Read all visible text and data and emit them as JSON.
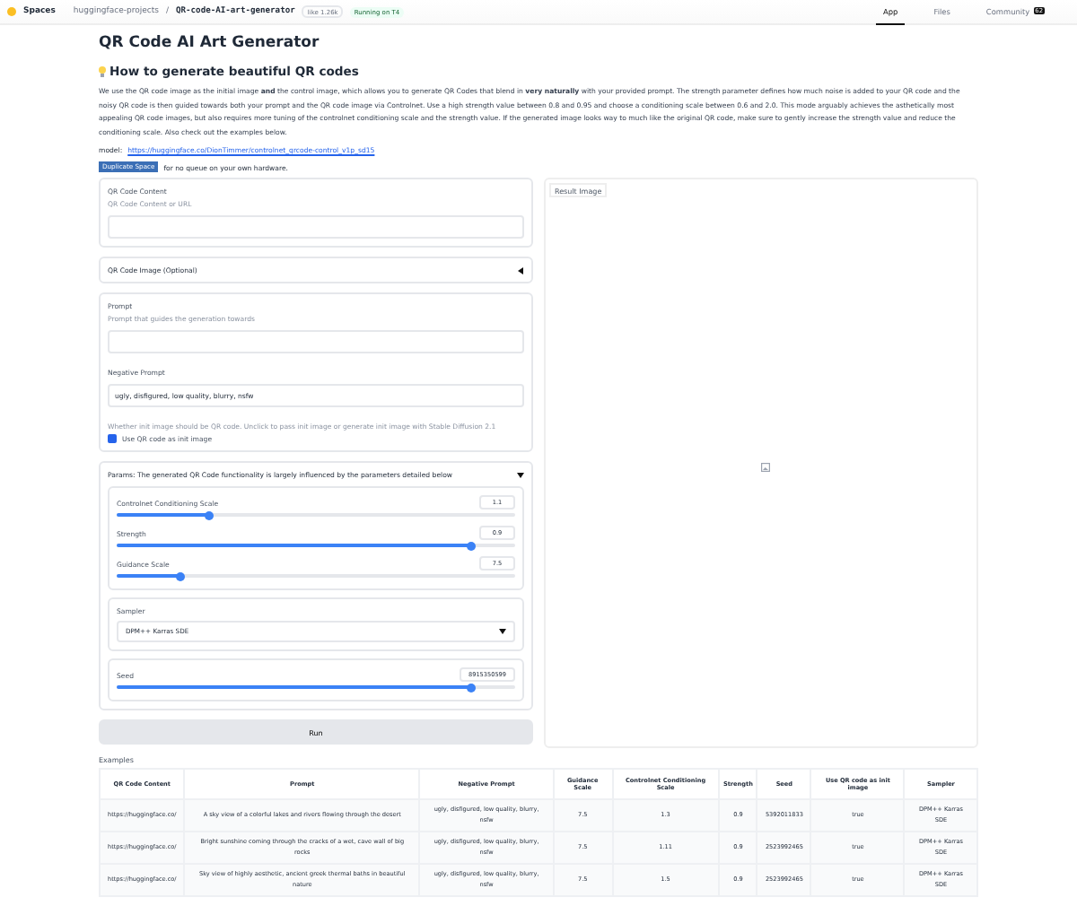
{
  "header": {
    "brand": "Spaces",
    "owner": "huggingface-projects",
    "slash": "/",
    "space": "QR-code-AI-art-generator",
    "like_label": "like",
    "like_count": "1.26k",
    "status": "Running on T4",
    "tabs": [
      {
        "label": "App",
        "selected": true
      },
      {
        "label": "Files",
        "selected": false
      },
      {
        "label": "Community",
        "selected": false,
        "count": "62"
      }
    ]
  },
  "title": "QR Code AI Art Generator",
  "subtitle": "How to generate beautiful QR codes",
  "description": "We use the QR code image as the initial image **and** the control image, which allows you to generate QR Codes that blend in **very naturally** with your provided prompt. The strength parameter defines how much noise is added to your QR code and the noisy QR code is then guided towards both your prompt and the QR code image via Controlnet. Use a high strength value between 0.8 and 0.95 and choose a conditioning scale between 0.6 and 2.0. This mode arguably achieves the asthetically most appealing QR code images, but also requires more tuning of the controlnet conditioning scale and the strength value. If the generated image looks way to much like the original QR code, make sure to gently increase the strength value and reduce the conditioning scale. Also check out the examples below.",
  "model_label": "model:",
  "model_link": "https://huggingface.co/DionTimmer/controlnet_qrcode-control_v1p_sd15",
  "duplicate": {
    "button": "Duplicate Space",
    "text": "for no queue on your own hardware."
  },
  "qr_content": {
    "label": "QR Code Content",
    "info": "QR Code Content or URL"
  },
  "qr_image": {
    "label": "QR Code Image (Optional)",
    "expanded": false
  },
  "prompt": {
    "label": "Prompt",
    "info": "Prompt that guides the generation towards"
  },
  "negative_prompt": {
    "label": "Negative Prompt",
    "value": "ugly, disfigured, low quality, blurry, nsfw"
  },
  "init_image": {
    "info": "Whether init image should be QR code. Unclick to pass init image or generate init image with Stable Diffusion 2.1",
    "label": "Use QR code as init image",
    "checked": true
  },
  "params": {
    "label": "Params: The generated QR Code functionality is largely influenced by the parameters detailed below",
    "expanded": true,
    "sliders": [
      {
        "label": "Controlnet Conditioning Scale",
        "value": "1.1",
        "level": 0.23
      },
      {
        "label": "Strength",
        "value": "0.9",
        "level": 0.89
      },
      {
        "label": "Guidance Scale",
        "value": "7.5",
        "level": 0.16
      }
    ],
    "sampler": {
      "label": "Sampler",
      "value": "DPM++ Karras SDE"
    },
    "seed": {
      "label": "Seed",
      "value": "8915350599",
      "level": 0.89
    }
  },
  "run": "Run",
  "result_label": "Result Image",
  "examples": {
    "label": "Examples",
    "columns": [
      "QR Code Content",
      "Prompt",
      "Negative Prompt",
      "Guidance Scale",
      "Controlnet Conditioning Scale",
      "Strength",
      "Seed",
      "Use QR code as init image",
      "Sampler"
    ],
    "rows": [
      [
        "https://huggingface.co/",
        "A sky view of a colorful lakes and rivers flowing through the desert",
        "ugly, disfigured, low quality, blurry, nsfw",
        "7.5",
        "1.3",
        "0.9",
        "5392011833",
        "true",
        "DPM++ Karras SDE"
      ],
      [
        "https://huggingface.co/",
        "Bright sunshine coming through the cracks of a wet, cave wall of big rocks",
        "ugly, disfigured, low quality, blurry, nsfw",
        "7.5",
        "1.11",
        "0.9",
        "2523992465",
        "true",
        "DPM++ Karras SDE"
      ],
      [
        "https://huggingface.co/",
        "Sky view of highly aesthetic, ancient greek thermal baths in beautiful nature",
        "ugly, disfigured, low quality, blurry, nsfw",
        "7.5",
        "1.5",
        "0.9",
        "2523992465",
        "true",
        "DPM++ Karras SDE"
      ]
    ]
  }
}
